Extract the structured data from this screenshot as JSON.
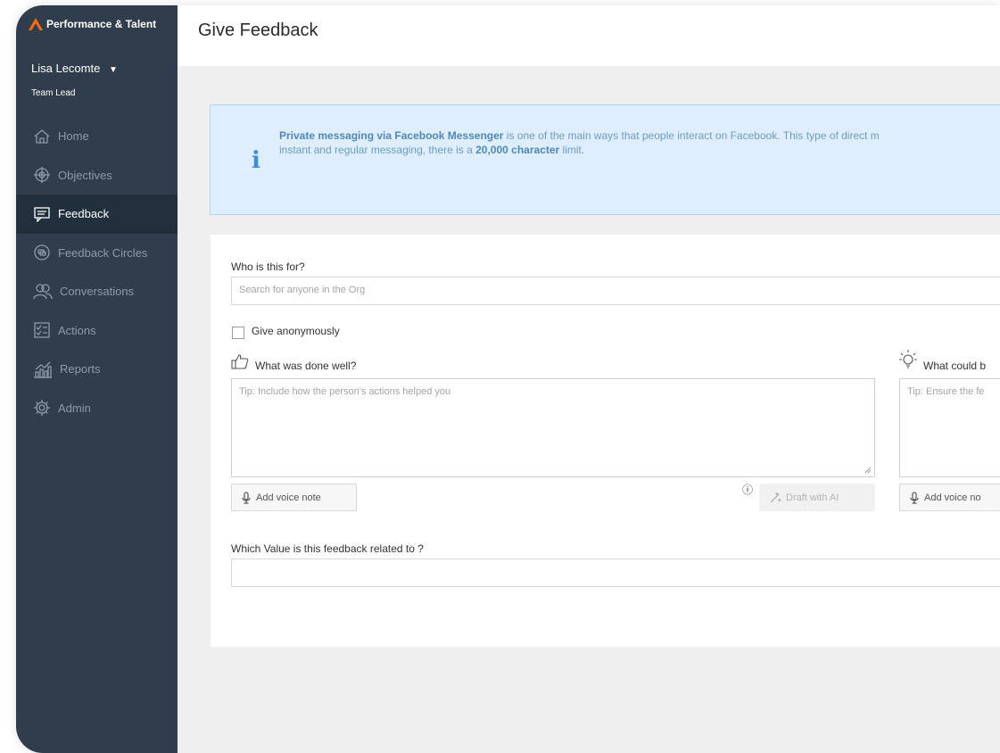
{
  "brand": {
    "name": "Performance & Talent",
    "accent": "#ff6a13"
  },
  "user": {
    "name": "Lisa Lecomte",
    "dropdown_glyph": "▼",
    "role": "Team Lead"
  },
  "nav": [
    {
      "label": "Home",
      "icon": "home-icon"
    },
    {
      "label": "Objectives",
      "icon": "target-icon"
    },
    {
      "label": "Feedback",
      "icon": "chat-icon",
      "active": true
    },
    {
      "label": "Feedback Circles",
      "icon": "circles-icon"
    },
    {
      "label": "Conversations",
      "icon": "people-icon"
    },
    {
      "label": "Actions",
      "icon": "checklist-icon"
    },
    {
      "label": "Reports",
      "icon": "chart-icon"
    },
    {
      "label": "Admin",
      "icon": "gear-icon"
    }
  ],
  "page": {
    "title": "Give Feedback"
  },
  "info": {
    "icon": "i",
    "bold1": "Private messaging via Facebook Messenger",
    "text1": " is one of the main ways that people interact on Facebook. This type of direct m",
    "text2": "instant and regular messaging, there is a ",
    "bold2": "20,000 character",
    "text3": " limit."
  },
  "form": {
    "who_label": "Who is this for?",
    "who_placeholder": "Search for anyone in the Org",
    "anon_label": "Give anonymously",
    "well_label": "What was done well?",
    "well_placeholder": "Tip: Include how the person's actions helped you",
    "could_label": "What could b",
    "could_placeholder": "Tip: Ensure the fe",
    "voice_label": "Add voice note",
    "voice_label_2": "Add voice no",
    "draft_label": "Draft with AI",
    "info_glyph": "ⓘ",
    "value_label": "Which Value is this feedback related to ?",
    "value_value": ""
  }
}
